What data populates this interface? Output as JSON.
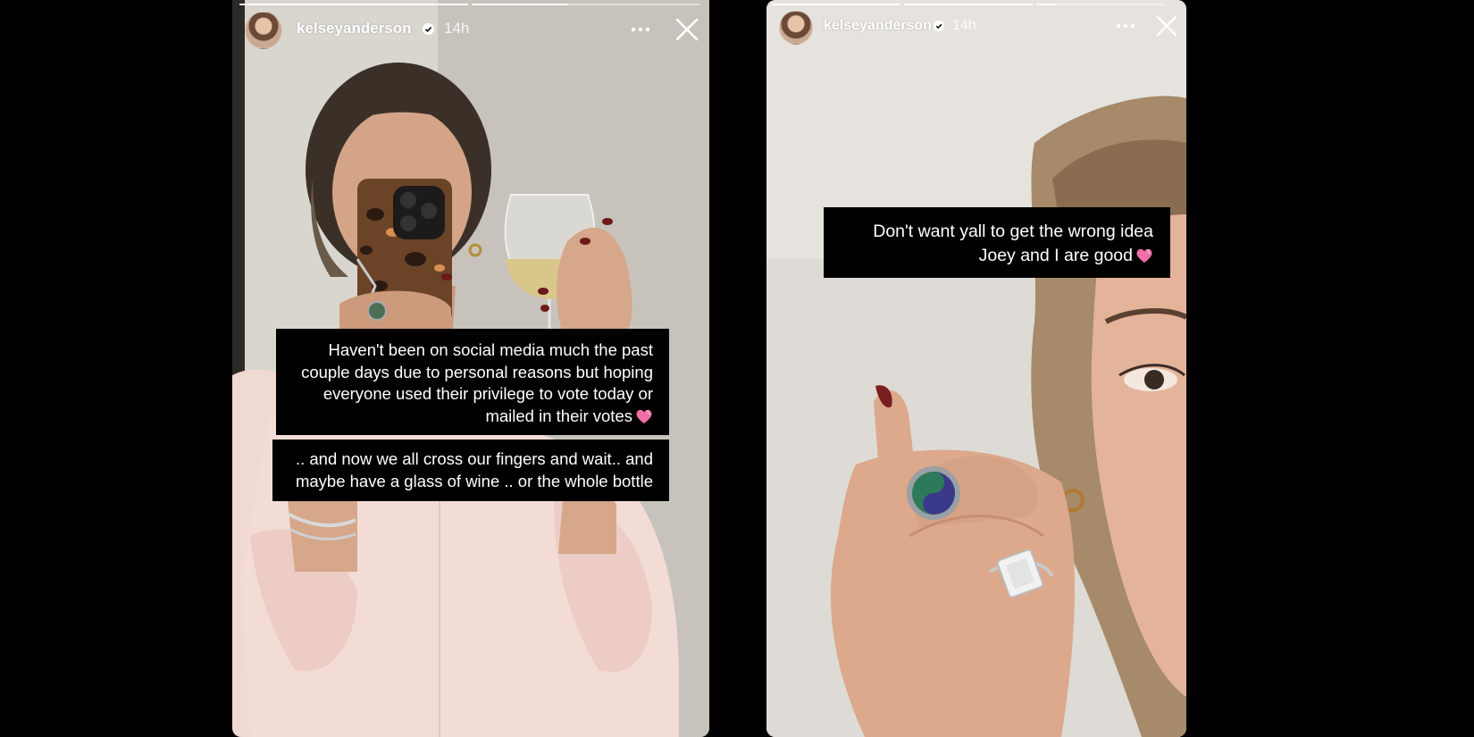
{
  "stories": [
    {
      "id": "left",
      "username": "kelseyanderson",
      "timestamp": "14h",
      "verified": true,
      "progress": [
        1,
        0.42
      ],
      "caption_blocks": [
        {
          "lines": [
            "Haven't been on social media much the past",
            "couple days due to personal reasons but hoping",
            "everyone used their privilege to vote today or",
            "mailed in their votes"
          ],
          "ends_with_icon": "pink-heart-icon"
        },
        {
          "lines": [
            ".. and now we all cross our fingers and wait.. and",
            "maybe have a glass of wine .. or the whole bottle"
          ],
          "ends_with_icon": null
        }
      ]
    },
    {
      "id": "right",
      "username": "kelseyanderson",
      "timestamp": "14h",
      "verified": true,
      "progress": [
        1,
        1,
        0.15
      ],
      "caption_blocks": [
        {
          "lines": [
            "Don't want yall to get the wrong idea",
            "Joey and I are good"
          ],
          "ends_with_icon": "pink-heart-icon"
        }
      ]
    }
  ],
  "icons": {
    "verified": "verified-badge-icon",
    "more": "more-options-icon",
    "close": "close-icon",
    "heart": "pink-heart-icon"
  },
  "colors": {
    "background": "#000000",
    "caption_bg": "#000000",
    "caption_text": "#ffffff",
    "heart": "#f06fa5"
  }
}
